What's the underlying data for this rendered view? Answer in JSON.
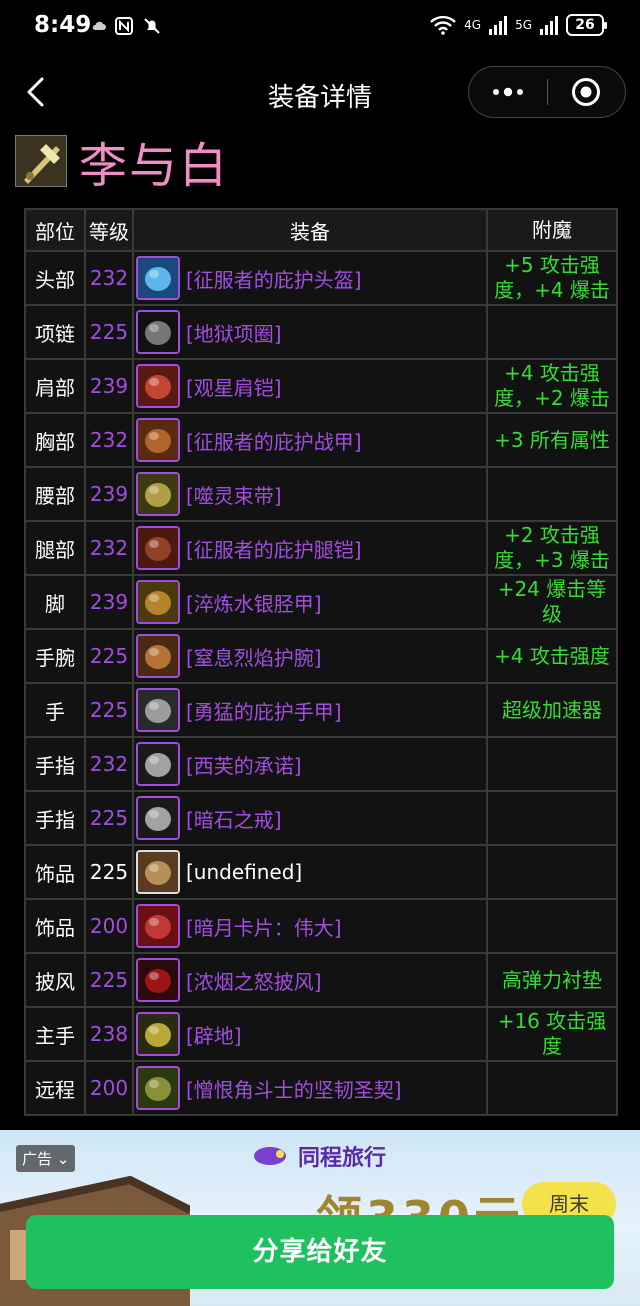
{
  "status_bar": {
    "time": "8:49",
    "network_1": "4G",
    "network_2": "5G",
    "battery": "26"
  },
  "nav": {
    "title": "装备详情"
  },
  "character": {
    "name": "李与白"
  },
  "table": {
    "headers": [
      "部位",
      "等级",
      "装备",
      "附魔"
    ],
    "rows": [
      {
        "slot": "头部",
        "level": "232",
        "item": "[征服者的庇护头盔]",
        "enchant": "+5 攻击强度，+4 爆击",
        "quality": "epic",
        "icon": "helmet-icon"
      },
      {
        "slot": "项链",
        "level": "225",
        "item": "[地狱项圈]",
        "enchant": "",
        "quality": "epic",
        "icon": "collar-icon"
      },
      {
        "slot": "肩部",
        "level": "239",
        "item": "[观星肩铠]",
        "enchant": "+4 攻击强度，+2 爆击",
        "quality": "epic",
        "icon": "shoulder-icon"
      },
      {
        "slot": "胸部",
        "level": "232",
        "item": "[征服者的庇护战甲]",
        "enchant": "+3 所有属性",
        "quality": "epic",
        "icon": "chest-armor-icon"
      },
      {
        "slot": "腰部",
        "level": "239",
        "item": "[噬灵束带]",
        "enchant": "",
        "quality": "epic",
        "icon": "belt-icon"
      },
      {
        "slot": "腿部",
        "level": "232",
        "item": "[征服者的庇护腿铠]",
        "enchant": "+2 攻击强度，+3 爆击",
        "quality": "epic",
        "icon": "leg-armor-icon"
      },
      {
        "slot": "脚",
        "level": "239",
        "item": "[淬炼水银胫甲]",
        "enchant": "+24 爆击等级",
        "quality": "epic",
        "icon": "boots-icon"
      },
      {
        "slot": "手腕",
        "level": "225",
        "item": "[窒息烈焰护腕]",
        "enchant": "+4 攻击强度",
        "quality": "epic",
        "icon": "bracer-icon"
      },
      {
        "slot": "手",
        "level": "225",
        "item": "[勇猛的庇护手甲]",
        "enchant": "超级加速器",
        "quality": "epic",
        "icon": "gauntlet-icon"
      },
      {
        "slot": "手指",
        "level": "232",
        "item": "[西芙的承诺]",
        "enchant": "",
        "quality": "epic",
        "icon": "ring-icon"
      },
      {
        "slot": "手指",
        "level": "225",
        "item": "[暗石之戒]",
        "enchant": "",
        "quality": "epic",
        "icon": "ring-icon"
      },
      {
        "slot": "饰品",
        "level": "225",
        "item": "[undefined]",
        "enchant": "",
        "quality": "common",
        "icon": "trinket-icon"
      },
      {
        "slot": "饰品",
        "level": "200",
        "item": "[暗月卡片：伟大]",
        "enchant": "",
        "quality": "epic",
        "icon": "card-icon"
      },
      {
        "slot": "披风",
        "level": "225",
        "item": "[浓烟之怒披风]",
        "enchant": "高弹力衬垫",
        "quality": "epic",
        "icon": "cloak-icon"
      },
      {
        "slot": "主手",
        "level": "238",
        "item": "[辟地]",
        "enchant": "+16 攻击强度",
        "quality": "epic",
        "icon": "mace-icon"
      },
      {
        "slot": "远程",
        "level": "200",
        "item": "[憎恨角斗士的坚韧圣契]",
        "enchant": "",
        "quality": "epic",
        "icon": "libram-icon"
      }
    ]
  },
  "ad": {
    "tag": "广告",
    "brand": "同程旅行",
    "slogan": "领330元",
    "badge": "周末"
  },
  "share_button": {
    "label": "分享给好友"
  },
  "colors": {
    "epic": "#a24de0",
    "enchant": "#33dd33",
    "name": "#f28cc6",
    "share": "#1fc060"
  }
}
